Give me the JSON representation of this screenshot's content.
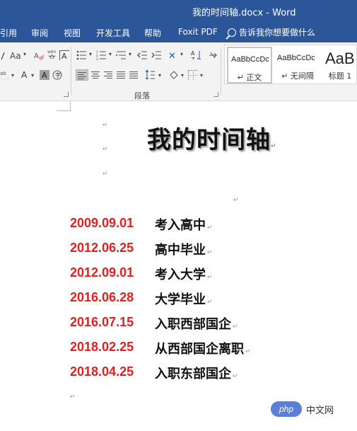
{
  "window": {
    "title": "我的时间轴.docx  -  Word"
  },
  "menu": {
    "tabs": [
      "引用",
      "审阅",
      "视图",
      "开发工具",
      "帮助",
      "Foxit PDF"
    ],
    "tell_me": "告诉我你想要做什么"
  },
  "ribbon": {
    "font_size_grow": "Aa",
    "paragraph_group_label": "段落",
    "sort_icon_label": "A↓Z",
    "styles": [
      {
        "sample": "AaBbCcDc",
        "name": "正文",
        "selected": true
      },
      {
        "sample": "AaBbCcDc",
        "name": "无间隔",
        "selected": false
      },
      {
        "sample": "AaB",
        "name": "标题 1",
        "selected": false
      }
    ]
  },
  "document": {
    "title": "我的时间轴",
    "timeline": [
      {
        "date": "2009.09.01",
        "event": "考入高中"
      },
      {
        "date": "2012.06.25",
        "event": "高中毕业"
      },
      {
        "date": "2012.09.01",
        "event": "考入大学"
      },
      {
        "date": "2016.06.28",
        "event": "大学毕业"
      },
      {
        "date": "2016.07.15",
        "event": "入职西部国企"
      },
      {
        "date": "2018.02.25",
        "event": "从西部国企离职"
      },
      {
        "date": "2018.04.25",
        "event": "入职东部国企"
      }
    ],
    "paragraph_mark": "↵"
  },
  "watermark": {
    "logo": "php",
    "text": "中文网"
  },
  "colors": {
    "titlebar": "#2b579a",
    "date_red": "#e02020"
  }
}
